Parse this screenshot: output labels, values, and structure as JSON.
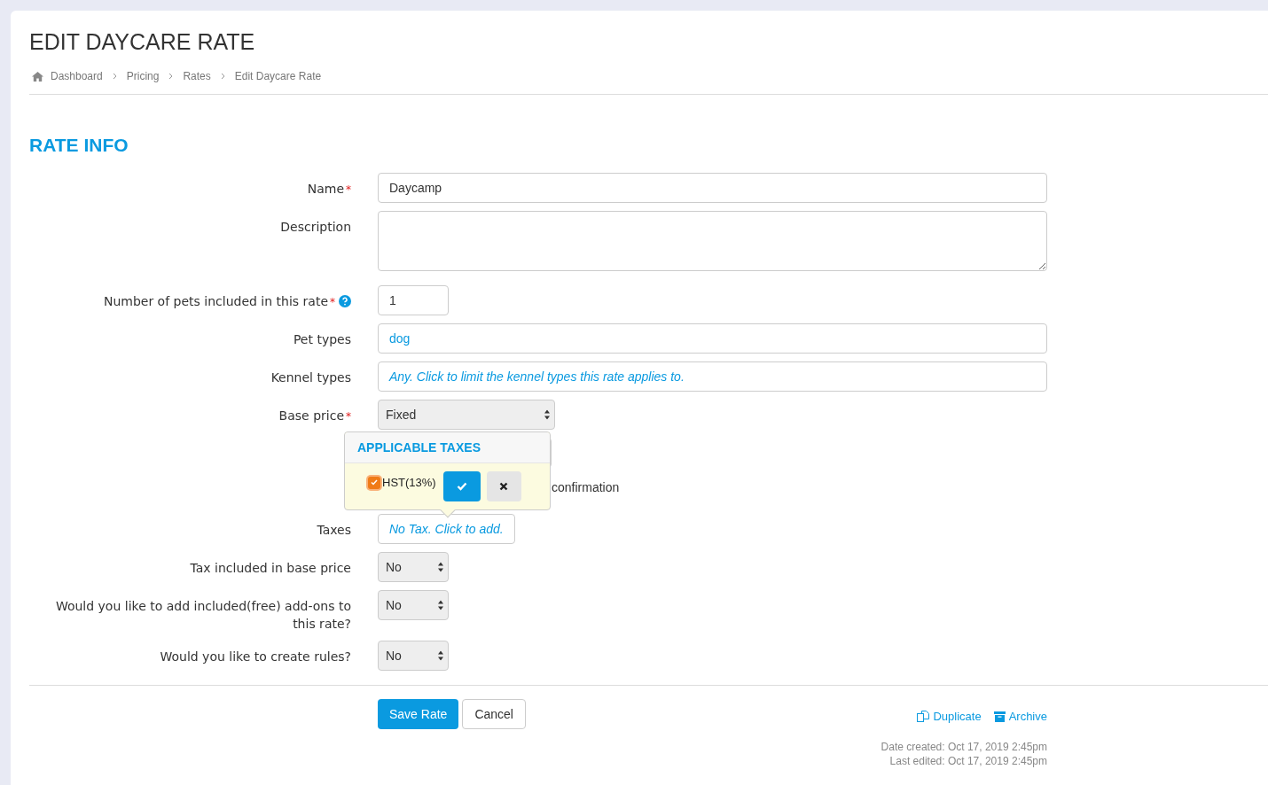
{
  "page": {
    "title": "EDIT DAYCARE RATE"
  },
  "breadcrumbs": [
    {
      "label": "Dashboard"
    },
    {
      "label": "Pricing"
    },
    {
      "label": "Rates"
    },
    {
      "label": "Edit Daycare Rate"
    }
  ],
  "section_title": "RATE INFO",
  "fields": [
    {
      "kind": "text",
      "label": "Name",
      "required_mark": "*",
      "value": "Daycamp"
    },
    {
      "kind": "textarea",
      "label": "Description"
    },
    {
      "kind": "number",
      "label": "Number of pets included in this rate",
      "required_mark": "*",
      "help": true,
      "value": "1"
    },
    {
      "kind": "link",
      "label": "Pet types",
      "value": "dog"
    },
    {
      "kind": "hint-link",
      "label": "Kennel types",
      "value": "Any. Click to limit the kennel types this rate applies to."
    },
    {
      "kind": "wide-select",
      "label": "Base price",
      "required_mark": "*",
      "value": "Fixed"
    },
    {
      "kind": "hidden-select"
    },
    {
      "kind": "note",
      "value": "confirmation"
    },
    {
      "kind": "short-hint-link",
      "label": "Taxes",
      "value": "No Tax. Click to add."
    },
    {
      "kind": "select",
      "label": "Tax included in base price",
      "value": "No"
    },
    {
      "kind": "select",
      "label": "Would you like to add included(free) add-ons to this rate?",
      "value": "No"
    },
    {
      "kind": "select",
      "label": "Would you like to create rules?",
      "value": "No"
    }
  ],
  "popover": {
    "title": "APPLICABLE TAXES",
    "options": [
      {
        "label": "HST(13%)",
        "checked": true
      }
    ]
  },
  "actions": {
    "save": "Save Rate",
    "cancel": "Cancel",
    "duplicate": "Duplicate",
    "archive": "Archive"
  },
  "meta": [
    "Date created: Oct 17, 2019 2:45pm",
    "Last edited: Oct 17, 2019 2:45pm"
  ]
}
